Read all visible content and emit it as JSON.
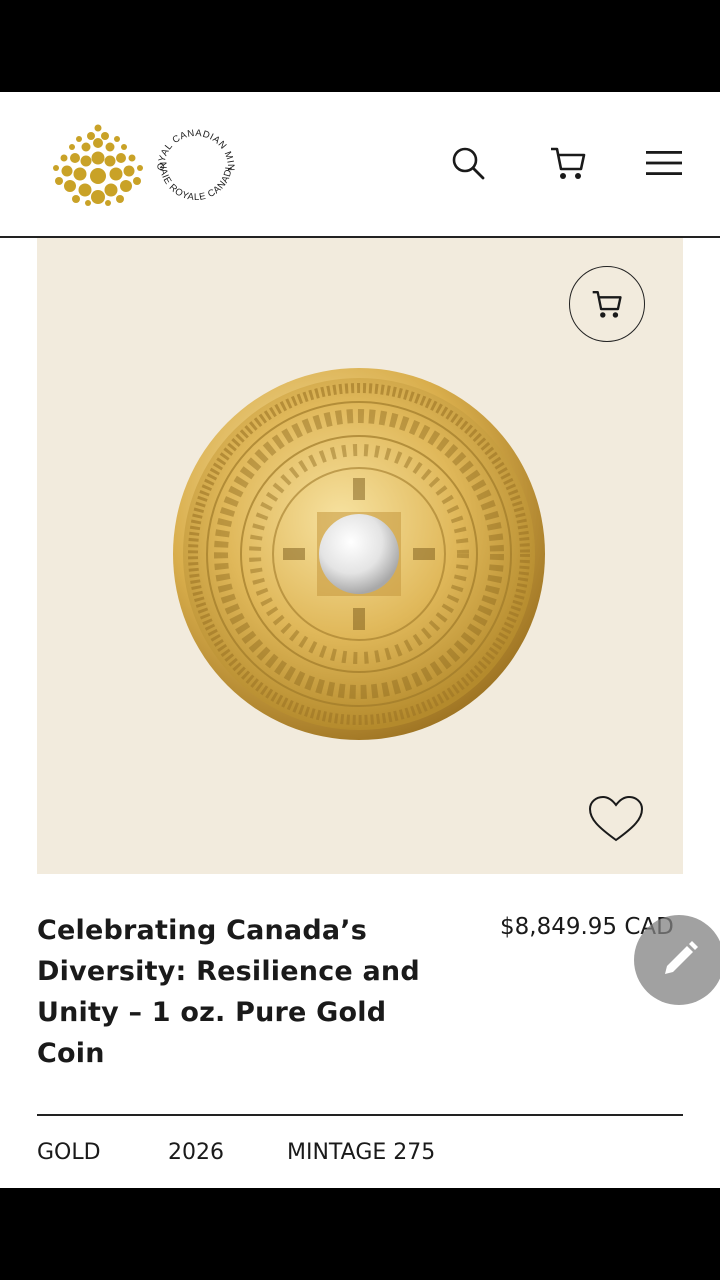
{
  "header": {
    "brand": {
      "name_en": "ROYAL CANADIAN MINT",
      "name_fr": "MONNAIE ROYALE CANADIENNE",
      "color": "#c9a227"
    },
    "icons": {
      "search": "search-icon",
      "cart": "cart-icon",
      "menu": "hamburger-menu-icon"
    }
  },
  "product": {
    "image_icons": {
      "add_to_cart": "cart-icon",
      "wishlist": "heart-icon"
    },
    "title": "Celebrating Canada’s Diversity: Resilience and Unity – 1 oz. Pure Gold Coin",
    "price": "$8,849.95 CAD",
    "attributes": {
      "metal": "GOLD",
      "year": "2026",
      "mintage": "MINTAGE 275"
    }
  },
  "overlay": {
    "edit_button_icon": "pencil-icon"
  },
  "colors": {
    "image_background": "#f2ebdd",
    "text": "#1a1a1a",
    "gold": "#c9a227"
  }
}
